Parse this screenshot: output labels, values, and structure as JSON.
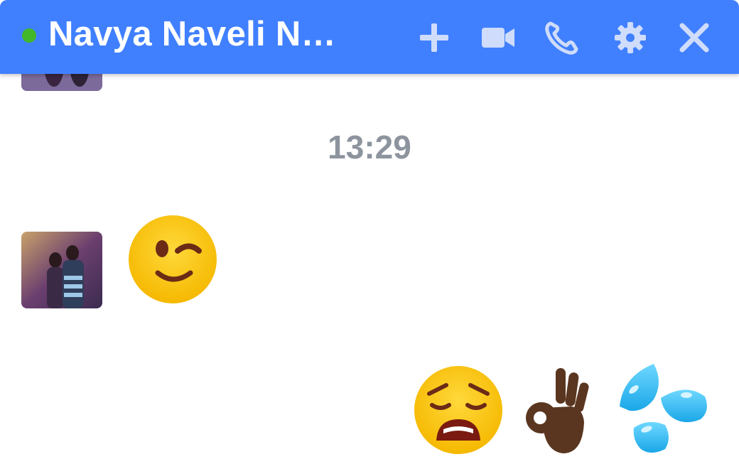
{
  "header": {
    "contact_name": "Navya Naveli N…",
    "online_status_color": "#42b72a",
    "accent_color": "#4080ff",
    "icons": [
      "plus-icon",
      "video-camera-icon",
      "phone-icon",
      "gear-icon",
      "close-icon"
    ]
  },
  "messages": {
    "timestamp": "13:29",
    "items": [
      {
        "from": "contact",
        "emoji": "winking-face"
      },
      {
        "from": "self",
        "emojis": [
          "weary-face",
          "ok-hand-dark-skin",
          "sweat-droplets"
        ]
      }
    ]
  }
}
